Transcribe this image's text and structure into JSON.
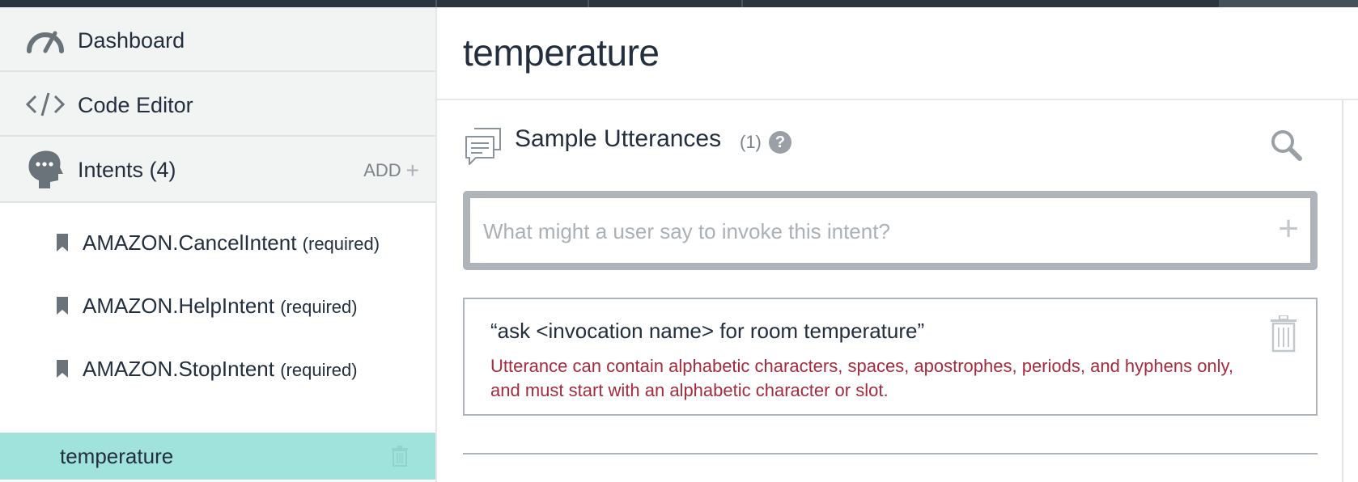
{
  "sidebar": {
    "nav": [
      {
        "label": "Dashboard",
        "icon": "gauge-icon"
      },
      {
        "label": "Code Editor",
        "icon": "code-icon"
      },
      {
        "label": "Intents (4)",
        "icon": "head-chat-icon",
        "action": "ADD"
      }
    ],
    "intents": [
      {
        "name": "AMAZON.CancelIntent",
        "tag": "(required)"
      },
      {
        "name": "AMAZON.HelpIntent",
        "tag": "(required)"
      },
      {
        "name": "AMAZON.StopIntent",
        "tag": "(required)"
      }
    ],
    "active_intent": {
      "name": "temperature",
      "highlight_color": "#9fe3dc"
    }
  },
  "main": {
    "title": "temperature",
    "section": {
      "title": "Sample Utterances",
      "count": "(1)",
      "help": "?"
    },
    "input": {
      "placeholder": "What might a user say to invoke this intent?",
      "value": ""
    },
    "utterances": [
      {
        "text": "“ask <invocation name> for room temperature”",
        "error": "Utterance can contain alphabetic characters, spaces, apostrophes, periods, and hyphens only, and must start with an alphabetic character or slot.",
        "error_color": "#a52a3d"
      }
    ]
  }
}
